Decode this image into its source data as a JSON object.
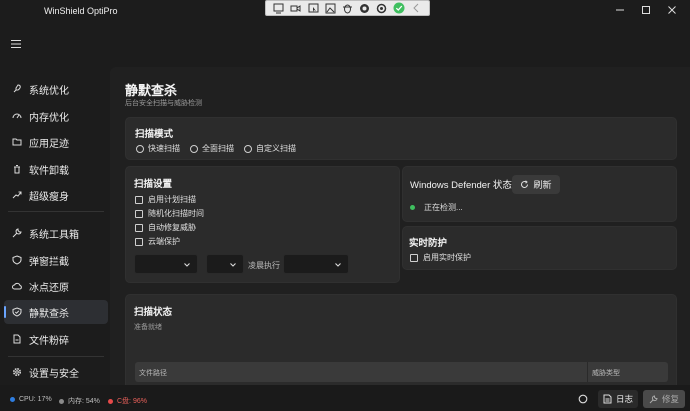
{
  "app": {
    "title": "WinShield OptiPro"
  },
  "sidebar": {
    "items": [
      {
        "label": "系统优化",
        "icon": "rocket-icon"
      },
      {
        "label": "内存优化",
        "icon": "gauge-icon"
      },
      {
        "label": "应用足迹",
        "icon": "folder-icon"
      },
      {
        "label": "软件卸载",
        "icon": "trash-icon"
      },
      {
        "label": "超级瘦身",
        "icon": "trend-up-icon"
      },
      {
        "label": "系统工具箱",
        "icon": "wrench-icon"
      },
      {
        "label": "弹窗拦截",
        "icon": "shield-icon"
      },
      {
        "label": "冰点还原",
        "icon": "cloud-icon"
      },
      {
        "label": "静默查杀",
        "icon": "shield-check-icon",
        "active": true
      },
      {
        "label": "文件粉碎",
        "icon": "file-icon"
      },
      {
        "label": "设置与安全",
        "icon": "gear-icon"
      }
    ]
  },
  "page": {
    "title": "静默查杀",
    "subtitle": "后台安全扫描与威胁检测"
  },
  "scan_mode": {
    "title": "扫描模式",
    "options": [
      "快速扫描",
      "全面扫描",
      "自定义扫描"
    ]
  },
  "scan_settings": {
    "title": "扫描设置",
    "options": [
      "启用计划扫描",
      "随机化扫描时间",
      "自动修复威胁",
      "云端保护"
    ],
    "schedule_label": "凌晨执行"
  },
  "defender": {
    "title": "Windows Defender 状态",
    "refresh_label": "刷新",
    "status_text": "正在检测..."
  },
  "realtime": {
    "title": "实时防护",
    "option": "启用实时保护"
  },
  "scan_status": {
    "title": "扫描状态",
    "status_text": "准备就绪",
    "columns": [
      "文件路径",
      "威胁类型"
    ]
  },
  "statusbar": {
    "cpu": "CPU: 17%",
    "memory": "内存: 54%",
    "disk": "C盘: 96%",
    "log_label": "日志",
    "repair_label": "修复"
  },
  "colors": {
    "accent": "#6aa5ff",
    "ok": "#3fbf5f",
    "warn": "#e84a4a",
    "cpu_dot": "#2e7de0",
    "mem_dot": "#8a8a8a"
  }
}
